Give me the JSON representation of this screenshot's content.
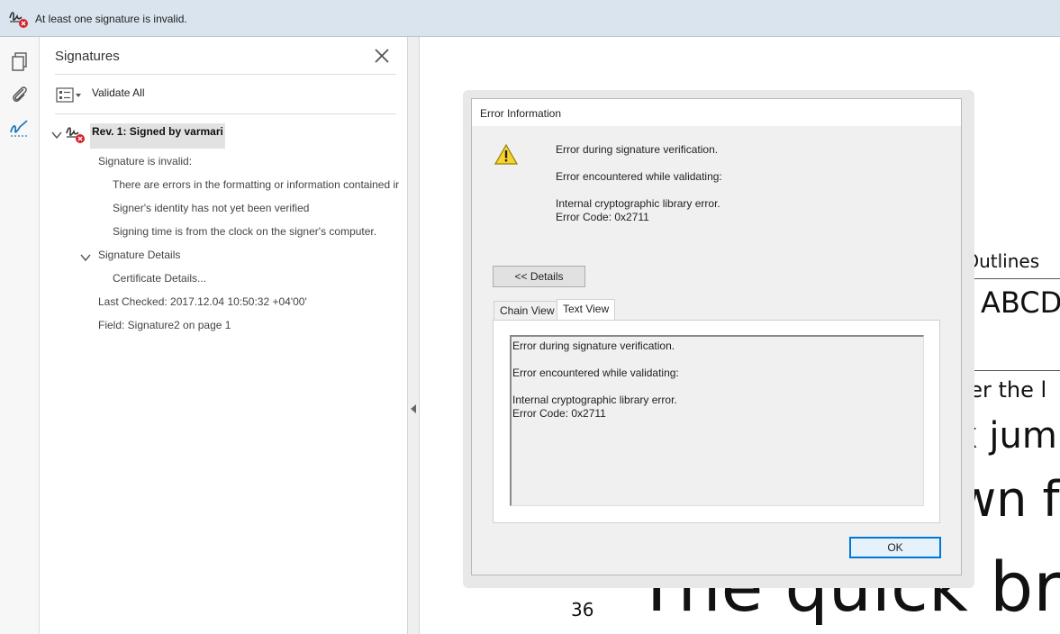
{
  "notification": {
    "message": "At least one signature is invalid.",
    "icon": "invalid-signature-icon"
  },
  "left_rail": {
    "icons": [
      "pages-icon",
      "attachment-icon",
      "signature-pen-icon"
    ]
  },
  "signatures_panel": {
    "title": "Signatures",
    "validate_all_label": "Validate All",
    "revision": {
      "label": "Rev. 1: Signed by varmari",
      "status_line": "Signature is invalid:",
      "issues": [
        "There are errors in the formatting or information contained ir",
        "Signer's identity has not yet been verified",
        "Signing time is from the clock on the signer's computer."
      ],
      "details_label": "Signature Details",
      "certificate_details_label": "Certificate Details...",
      "last_checked": "Last Checked: 2017.12.04 10:50:32 +04'00'",
      "field": "Field: Signature2 on page 1"
    }
  },
  "document": {
    "fragments": [
      "pe Outlines",
      "z ABCD",
      "ver the l",
      "x jump",
      "wn fo",
      "The quick br"
    ],
    "page_number": "36"
  },
  "dialog": {
    "title": "Error Information",
    "lines": [
      "Error during signature verification.",
      "Error encountered while validating:",
      "Internal cryptographic library error.",
      "Error Code: 0x2711"
    ],
    "details_button": "<< Details",
    "tabs": [
      "Chain View",
      "Text View"
    ],
    "active_tab": "Text View",
    "text_view_lines": [
      "Error during signature verification.",
      "Error encountered while validating:",
      "Internal cryptographic library error.",
      "Error Code: 0x2711"
    ],
    "ok_button": "OK"
  }
}
